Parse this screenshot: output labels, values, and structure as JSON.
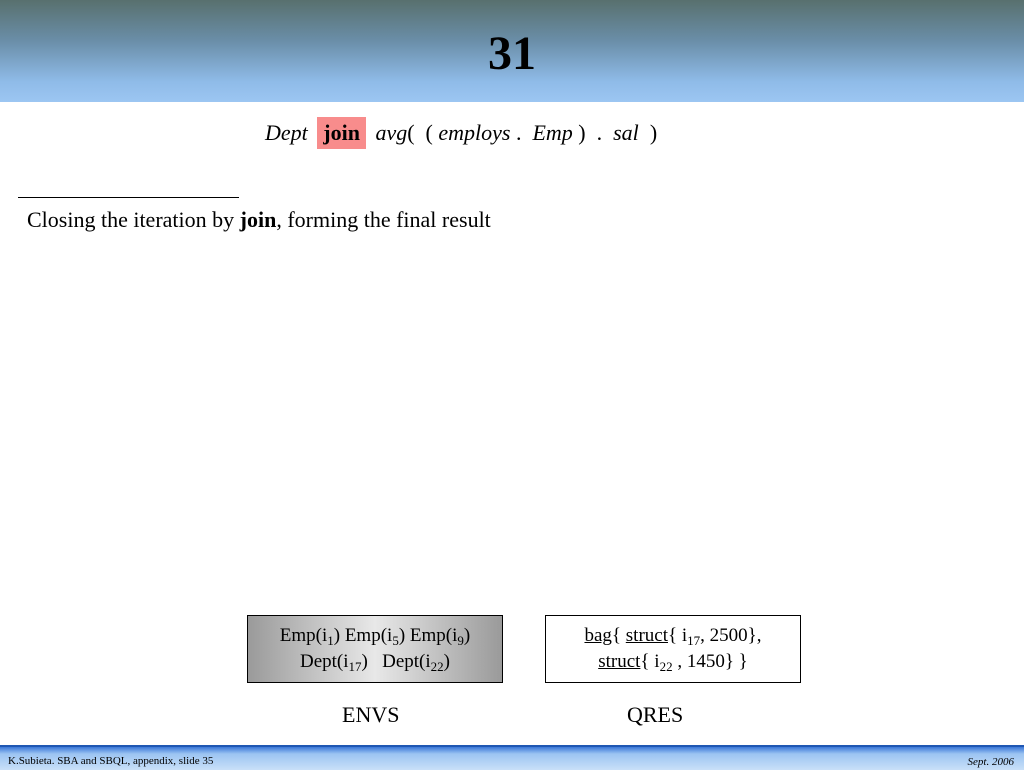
{
  "slide": {
    "number": "31"
  },
  "expression": {
    "dept": "Dept",
    "join": "join",
    "avg": "avg",
    "open_paren": "(",
    "inner_open": "(",
    "employs": "employs",
    "dot1": ".",
    "emp": "Emp",
    "inner_close": ")",
    "dot2": ".",
    "sal": "sal",
    "close_paren": ")"
  },
  "caption": {
    "prefix": "Closing the iteration by ",
    "keyword": "join",
    "suffix": ", forming the final result"
  },
  "envs": {
    "line1": [
      {
        "text": "Emp(i",
        "sub": "1",
        "after": ")"
      },
      {
        "text": " Emp(i",
        "sub": "5",
        "after": ")"
      },
      {
        "text": " Emp(i",
        "sub": "9",
        "after": ")"
      }
    ],
    "line2": [
      {
        "text": "Dept(i",
        "sub": "17",
        "after": ")"
      },
      {
        "text": "   Dept(i",
        "sub": "22",
        "after": ")"
      }
    ],
    "label": "ENVS"
  },
  "qres": {
    "bag_keyword": "bag",
    "struct_keyword": "struct",
    "line1_item_prefix": " i",
    "line1_item_sub": "17",
    "line1_value": ", 2500},",
    "line2_item_prefix": " i",
    "line2_item_sub": "22",
    "line2_value": " , 1450} }",
    "brace": "{",
    "label": "QRES"
  },
  "footer": {
    "left": "K.Subieta. SBA and SBQL, appendix, slide 35",
    "right": "Sept. 2006"
  }
}
